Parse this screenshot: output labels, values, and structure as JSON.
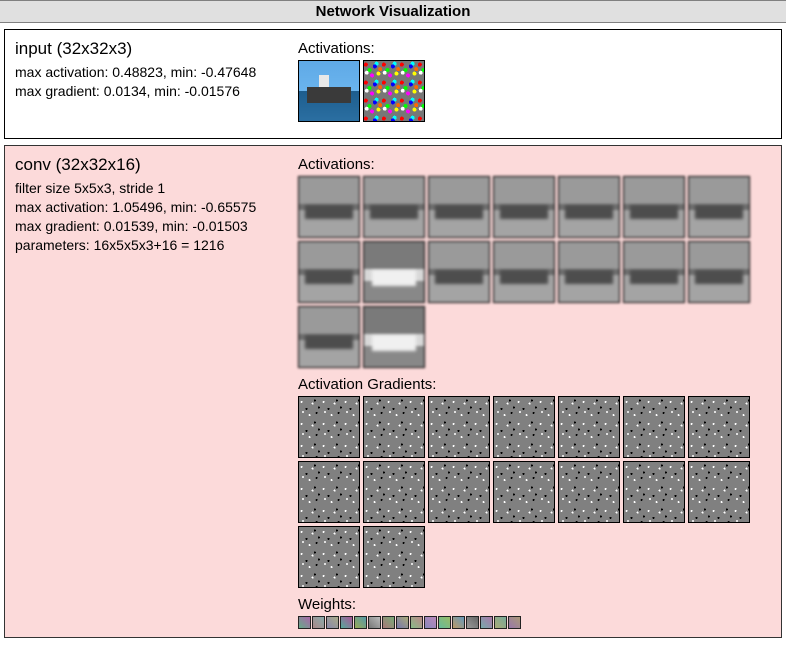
{
  "title": "Network Visualization",
  "layers": {
    "input": {
      "heading": "input (32x32x3)",
      "line1": "max activation: 0.48823, min: -0.47648",
      "line2": "max gradient: 0.0134, min: -0.01576",
      "activations_label": "Activations:"
    },
    "conv": {
      "heading": "conv (32x32x16)",
      "line1": "filter size 5x5x3, stride 1",
      "line2": "max activation: 1.05496, min: -0.65575",
      "line3": "max gradient: 0.01539, min: -0.01503",
      "line4": "parameters: 16x5x5x3+16 = 1216",
      "activations_label": "Activations:",
      "gradients_label": "Activation Gradients:",
      "weights_label": "Weights:"
    }
  }
}
